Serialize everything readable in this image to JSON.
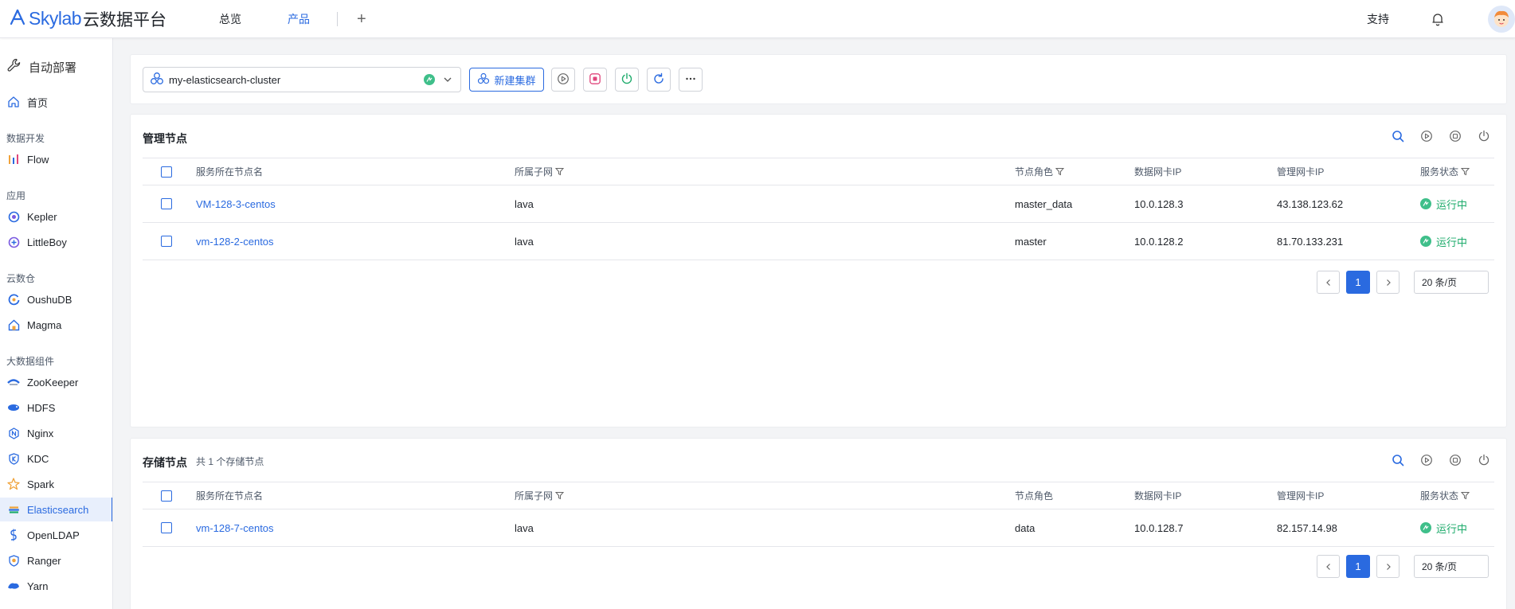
{
  "header": {
    "brand": "Skylab",
    "brand_sub": "云数据平台",
    "nav": [
      {
        "label": "总览",
        "active": false
      },
      {
        "label": "产品",
        "active": true
      }
    ],
    "support_label": "支持"
  },
  "sidebar": {
    "title": "自动部署",
    "home_label": "首页",
    "groups": [
      {
        "label": "数据开发",
        "items": [
          {
            "label": "Flow",
            "icon": "flow-icon"
          }
        ]
      },
      {
        "label": "应用",
        "items": [
          {
            "label": "Kepler",
            "icon": "kepler-icon"
          },
          {
            "label": "LittleBoy",
            "icon": "littleboy-icon"
          }
        ]
      },
      {
        "label": "云数仓",
        "items": [
          {
            "label": "OushuDB",
            "icon": "oushudb-icon"
          },
          {
            "label": "Magma",
            "icon": "magma-icon"
          }
        ]
      },
      {
        "label": "大数据组件",
        "items": [
          {
            "label": "ZooKeeper",
            "icon": "zookeeper-icon"
          },
          {
            "label": "HDFS",
            "icon": "hdfs-icon"
          },
          {
            "label": "Nginx",
            "icon": "nginx-icon"
          },
          {
            "label": "KDC",
            "icon": "kdc-icon"
          },
          {
            "label": "Spark",
            "icon": "spark-icon"
          },
          {
            "label": "Elasticsearch",
            "icon": "elasticsearch-icon",
            "active": true
          },
          {
            "label": "OpenLDAP",
            "icon": "openldap-icon"
          },
          {
            "label": "Ranger",
            "icon": "ranger-icon"
          },
          {
            "label": "Yarn",
            "icon": "yarn-icon"
          }
        ]
      }
    ]
  },
  "toolbar": {
    "cluster_name": "my-elasticsearch-cluster",
    "new_cluster_label": "新建集群"
  },
  "columns": {
    "hostname": "服务所在节点名",
    "subnet": "所属子网",
    "role": "节点角色",
    "data_ip": "数据网卡IP",
    "mgmt_ip": "管理网卡IP",
    "status": "服务状态"
  },
  "mgmt_nodes": {
    "title": "管理节点",
    "rows": [
      {
        "hostname": "VM-128-3-centos",
        "subnet": "lava",
        "role": "master_data",
        "data_ip": "10.0.128.3",
        "mgmt_ip": "43.138.123.62",
        "status": "运行中"
      },
      {
        "hostname": "vm-128-2-centos",
        "subnet": "lava",
        "role": "master",
        "data_ip": "10.0.128.2",
        "mgmt_ip": "81.70.133.231",
        "status": "运行中"
      }
    ],
    "page": "1",
    "page_size": "20 条/页"
  },
  "storage_nodes": {
    "title": "存储节点",
    "subtitle": "共 1 个存储节点",
    "rows": [
      {
        "hostname": "vm-128-7-centos",
        "subnet": "lava",
        "role": "data",
        "data_ip": "10.0.128.7",
        "mgmt_ip": "82.157.14.98",
        "status": "运行中"
      }
    ],
    "page": "1",
    "page_size": "20 条/页"
  },
  "colors": {
    "primary": "#2a6ae0",
    "running": "#1dab6b",
    "stop": "#e0457b"
  }
}
